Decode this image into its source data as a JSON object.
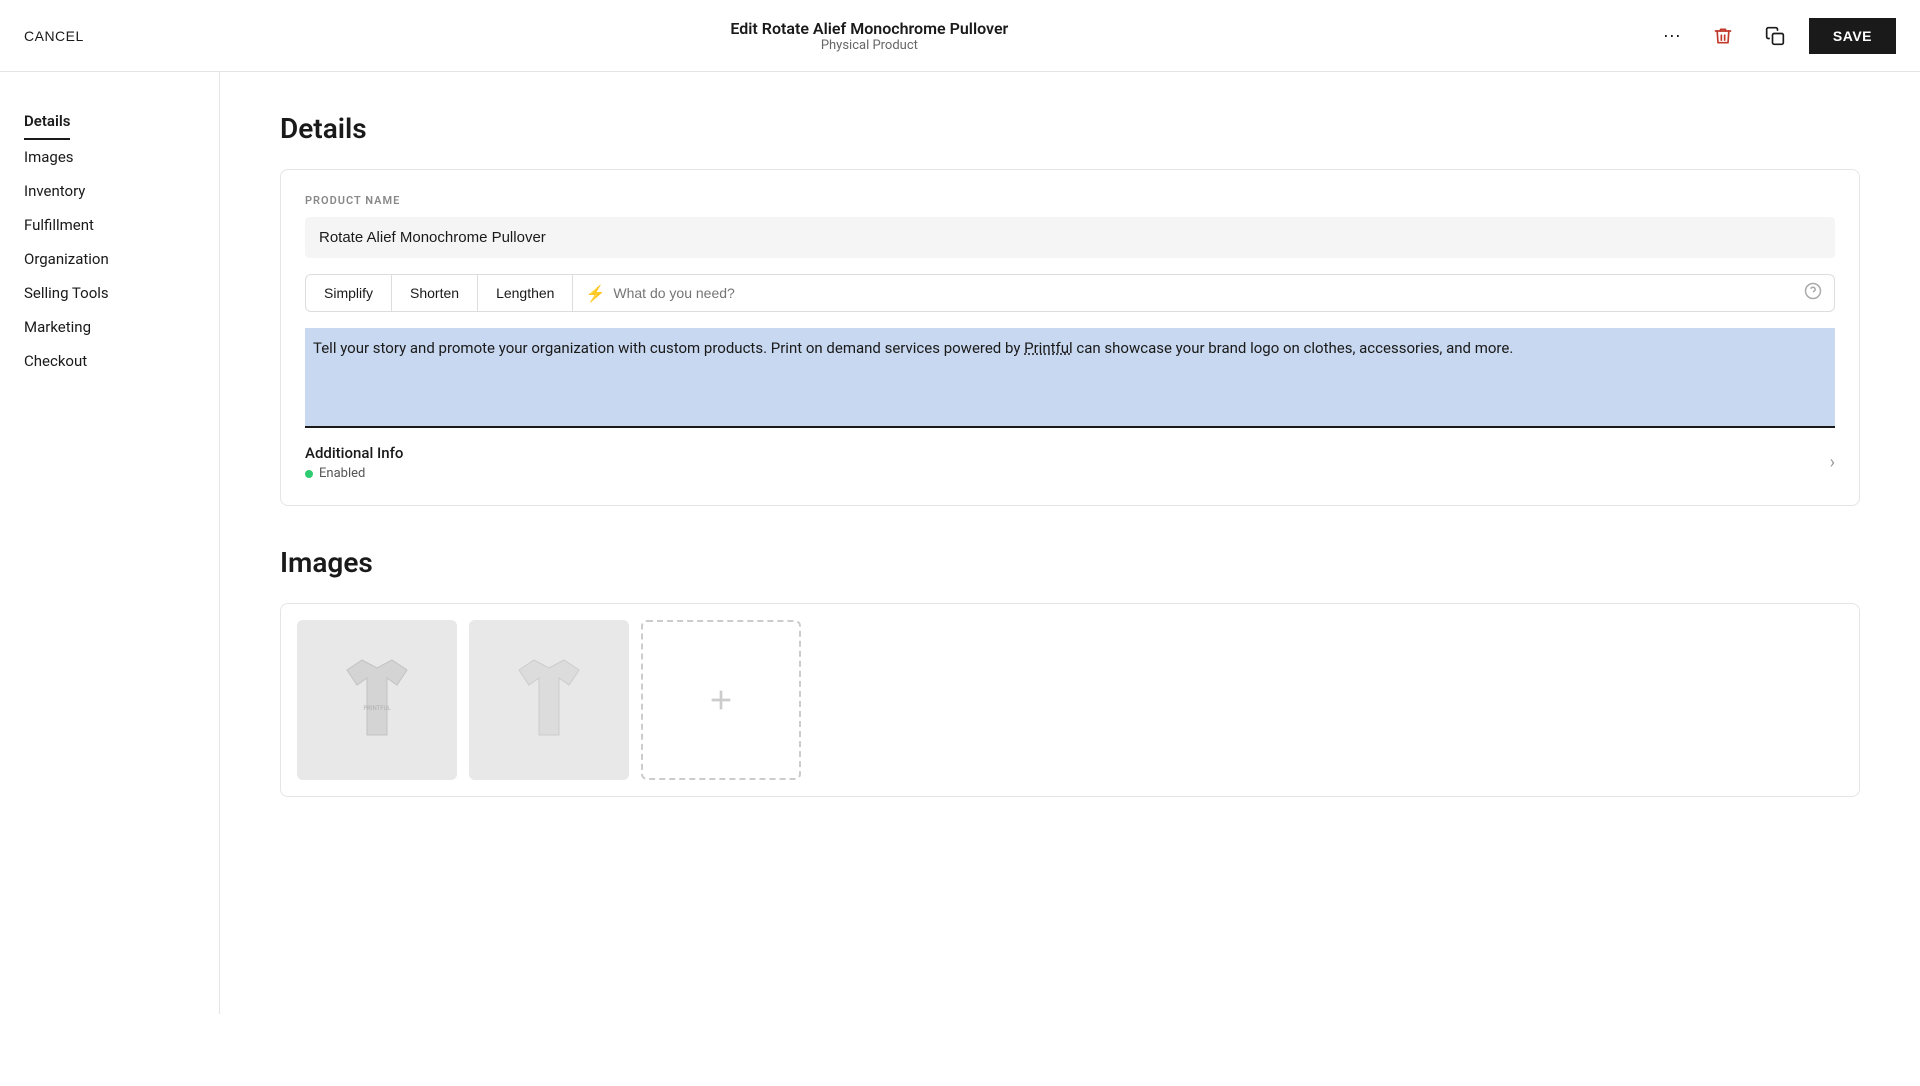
{
  "header": {
    "cancel_label": "CANCEL",
    "title": "Edit Rotate Alief Monochrome Pullover",
    "subtitle": "Physical Product",
    "save_label": "SAVE"
  },
  "sidebar": {
    "items": [
      {
        "id": "details",
        "label": "Details",
        "active": true
      },
      {
        "id": "images",
        "label": "Images",
        "active": false
      },
      {
        "id": "inventory",
        "label": "Inventory",
        "active": false
      },
      {
        "id": "fulfillment",
        "label": "Fulfillment",
        "active": false
      },
      {
        "id": "organization",
        "label": "Organization",
        "active": false
      },
      {
        "id": "selling-tools",
        "label": "Selling Tools",
        "active": false
      },
      {
        "id": "marketing",
        "label": "Marketing",
        "active": false
      },
      {
        "id": "checkout",
        "label": "Checkout",
        "active": false
      }
    ]
  },
  "details_section": {
    "title": "Details",
    "product_name_label": "PRODUCT NAME",
    "product_name_value": "Rotate Alief Monochrome Pullover",
    "ai_tabs": [
      {
        "id": "simplify",
        "label": "Simplify"
      },
      {
        "id": "shorten",
        "label": "Shorten"
      },
      {
        "id": "lengthen",
        "label": "Lengthen"
      }
    ],
    "ai_search_placeholder": "What do you need?",
    "description_text": "Tell your story and promote your organization with custom products. Print on demand services powered by Printful can showcase your brand logo on clothes, accessories, and more.",
    "additional_info": {
      "title": "Additional Info",
      "status": "Enabled"
    }
  },
  "images_section": {
    "title": "Images"
  },
  "icons": {
    "more": "···",
    "delete": "🗑",
    "duplicate": "⧉",
    "lightning": "⚡",
    "help": "?",
    "chevron_right": "›",
    "plus": "+"
  },
  "colors": {
    "accent": "#1a1a1a",
    "delete_red": "#c0392b",
    "highlight_blue": "#c8d8f0",
    "green": "#2ecc71",
    "border": "#e5e5e5"
  }
}
